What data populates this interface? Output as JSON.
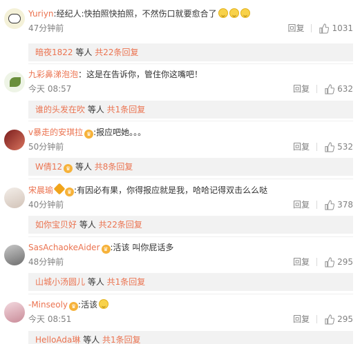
{
  "colors": {
    "username": "#eb7350",
    "meta": "#808080",
    "reply_bg": "#f2f2f2"
  },
  "comments": [
    {
      "user": "Yuriyn",
      "badge": "",
      "sep": ":",
      "text": "经纪人:快拍照快拍照，不然伤口就要愈合了",
      "emoji_count": 3,
      "time": "47分钟前",
      "reply_label": "回复",
      "likes": "1031",
      "replies": {
        "who": "暗夜1822",
        "mid": " 等人 ",
        "count": "共22条回复"
      }
    },
    {
      "user": "九彩鼻涕泡泡",
      "badge": "",
      "sep": "：",
      "text": "这是在告诉你，管住你这嘴吧！",
      "emoji_count": 0,
      "time": "今天 08:57",
      "reply_label": "回复",
      "likes": "632",
      "replies": {
        "who": "谁的头发在吹",
        "mid": " 等人 ",
        "count": "共1条回复"
      }
    },
    {
      "user": "v暴走的安琪拉",
      "badge": "vip",
      "sep": ":",
      "text": "报应吧她。。。",
      "emoji_count": 0,
      "time": "50分钟前",
      "reply_label": "回复",
      "likes": "532",
      "replies": {
        "who": "W倩12",
        "mid": " 等人 ",
        "count": "共8条回复"
      }
    },
    {
      "user": "宋晨瑜",
      "badge": "vip2",
      "sep": ":",
      "text": "有因必有果，你得报应就是我，哈哈记得双击么么哒",
      "emoji_count": 0,
      "time": "40分钟前",
      "reply_label": "回复",
      "likes": "378",
      "replies": {
        "who": "如你宝贝好",
        "mid": " 等人 ",
        "count": "共22条回复"
      }
    },
    {
      "user": "SasAchaokeAider",
      "badge": "vip",
      "sep": ":",
      "text": "活该 叫你屁话多",
      "emoji_count": 0,
      "time": "48分钟前",
      "reply_label": "回复",
      "likes": "295",
      "replies": {
        "who": "山城小汤圆儿",
        "mid": " 等人 ",
        "count": "共1条回复"
      }
    },
    {
      "user": "-Minseoly",
      "badge": "vip",
      "sep": ":",
      "text": "活该",
      "emoji_count": 1,
      "time": "今天 08:51",
      "reply_label": "回复",
      "likes": "295",
      "replies": {
        "who": "HelloAda琳",
        "mid": " 等人 ",
        "count": "共1条回复"
      }
    }
  ]
}
